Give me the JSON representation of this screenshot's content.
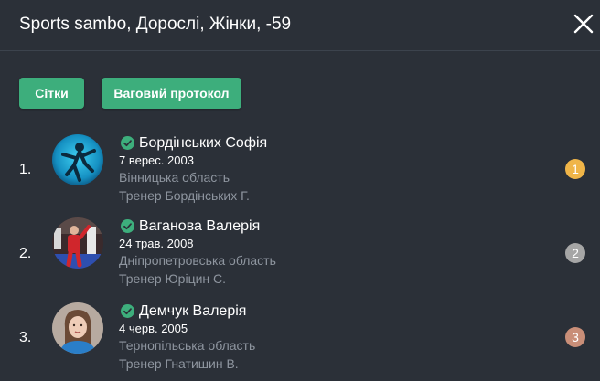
{
  "header": {
    "title": "Sports sambo, Дорослі, Жінки, -59",
    "close_icon": "close-icon"
  },
  "toolbar": {
    "grids_label": "Сітки",
    "weigh_in_label": "Ваговий протокол"
  },
  "colors": {
    "background": "#2b3038",
    "accent_green": "#3dae7c",
    "muted_text": "#8e959f",
    "gold": "#f0b548",
    "silver": "#a6a6a6",
    "bronze": "#c98e78"
  },
  "athletes": [
    {
      "rank": "1.",
      "name": "Бордінських Софія",
      "dob": "7 верес. 2003",
      "region": "Вінницька область",
      "coach": "Тренер Бордінських Г.",
      "place": "1",
      "verified_icon": "verified-check-icon"
    },
    {
      "rank": "2.",
      "name": "Ваганова Валерія",
      "dob": "24 трав. 2008",
      "region": "Дніпропетровська область",
      "coach": "Тренер Юріцин С.",
      "place": "2",
      "verified_icon": "verified-check-icon"
    },
    {
      "rank": "3.",
      "name": "Демчук Валерія",
      "dob": "4 черв. 2005",
      "region": "Тернопільська область",
      "coach": "Тренер Гнатишин В.",
      "place": "3",
      "verified_icon": "verified-check-icon"
    }
  ]
}
